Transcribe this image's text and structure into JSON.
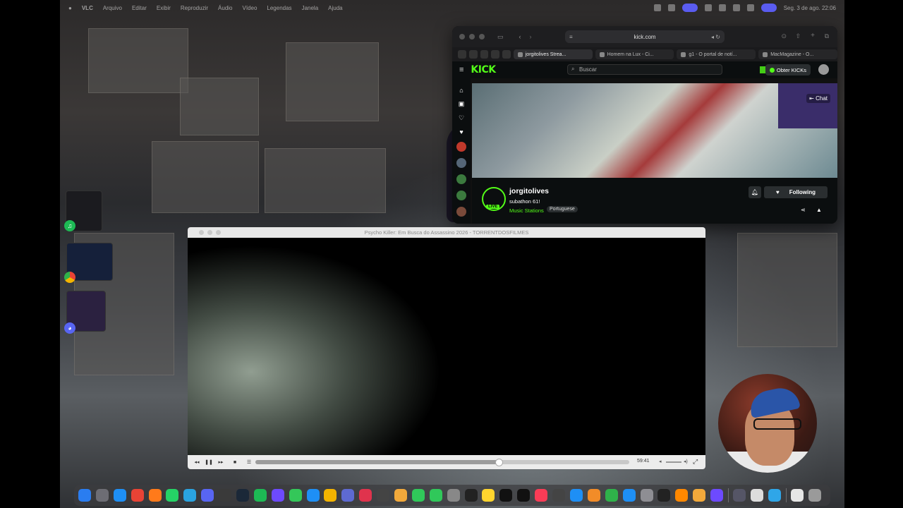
{
  "menubar": {
    "apple": "",
    "app_name": "VLC",
    "items": [
      "Arquivo",
      "Editar",
      "Exibir",
      "Reproduzir",
      "Áudio",
      "Vídeo",
      "Legendas",
      "Janela",
      "Ajuda"
    ],
    "clock": "Seg. 3 de ago. 22:06"
  },
  "stage_manager": [
    {
      "app": "Spotify",
      "icon": "spotify-icon",
      "color": "#1db954"
    },
    {
      "app": "Chrome",
      "icon": "chrome-icon",
      "color": "#e9c32c"
    },
    {
      "app": "Discord",
      "icon": "discord-icon",
      "color": "#5865f2"
    }
  ],
  "browser": {
    "url": "kick.com",
    "tabs": [
      {
        "label": "jorgitolives Strea...",
        "active": true
      },
      {
        "label": "Homem na Lux - Ci...",
        "active": false
      },
      {
        "label": "g1 - O portal de notí...",
        "active": false
      },
      {
        "label": "MacMagazine - O...",
        "active": false
      }
    ],
    "kick": {
      "logo": "KICK",
      "search_placeholder": "Buscar",
      "get_kicks_label": "Obter KICKs",
      "chat_label": "Chat",
      "channel": {
        "name": "jorgitolives",
        "title": "subathon 61!",
        "category": "Music Stations",
        "tag": "Portuguese",
        "live_badge": "LIVE",
        "follow_label": "Following"
      }
    }
  },
  "vlc": {
    "title": "Psycho Killer: Em Busca do Assassino 2026 - TORRENTDOSFILMES",
    "elapsed": "59:41",
    "progress": 0.65
  },
  "dock": {
    "apps": [
      {
        "name": "Finder",
        "icon": "finder-icon",
        "color": "#2a7df0"
      },
      {
        "name": "Launchpad",
        "icon": "launchpad-icon",
        "color": "#6d6d74"
      },
      {
        "name": "Safari",
        "icon": "safari-icon",
        "color": "#1e8ff5"
      },
      {
        "name": "Chrome",
        "icon": "chrome-icon",
        "color": "#e84335"
      },
      {
        "name": "Firefox",
        "icon": "firefox-icon",
        "color": "#ff7a1a"
      },
      {
        "name": "WhatsApp",
        "icon": "whatsapp-icon",
        "color": "#25d366"
      },
      {
        "name": "Telegram",
        "icon": "telegram-icon",
        "color": "#2aa3e0"
      },
      {
        "name": "Discord",
        "icon": "discord-icon",
        "color": "#5865f2"
      },
      {
        "name": "Audio",
        "icon": "audio-icon",
        "color": "#3a3a3a"
      },
      {
        "name": "Steam",
        "icon": "steam-icon",
        "color": "#1b2838"
      },
      {
        "name": "Spotify",
        "icon": "spotify-icon",
        "color": "#1db954"
      },
      {
        "name": "Proton",
        "icon": "shield-icon",
        "color": "#6d4aff"
      },
      {
        "name": "Messages",
        "icon": "messages-icon",
        "color": "#34c759"
      },
      {
        "name": "Mail",
        "icon": "mail-icon",
        "color": "#1e8ff5"
      },
      {
        "name": "Drive",
        "icon": "drive-icon",
        "color": "#f4b400"
      },
      {
        "name": "Linear",
        "icon": "linear-icon",
        "color": "#5e6ad2"
      },
      {
        "name": "Shortcuts",
        "icon": "shortcuts-icon",
        "color": "#e0334d"
      },
      {
        "name": "Screenshot",
        "icon": "screenshot-icon",
        "color": "#444"
      },
      {
        "name": "Photos",
        "icon": "photos-icon",
        "color": "#f2a93b"
      },
      {
        "name": "FaceTime",
        "icon": "facetime-icon",
        "color": "#30c85a"
      },
      {
        "name": "Phone",
        "icon": "phone-icon",
        "color": "#30c85a"
      },
      {
        "name": "Contacts",
        "icon": "contacts-icon",
        "color": "#888"
      },
      {
        "name": "Activity",
        "icon": "activity-icon",
        "color": "#222"
      },
      {
        "name": "Notes",
        "icon": "notes-icon",
        "color": "#ffd52e"
      },
      {
        "name": "TV",
        "icon": "tv-icon",
        "color": "#111"
      },
      {
        "name": "Capcut",
        "icon": "capcut-icon",
        "color": "#111"
      },
      {
        "name": "Music",
        "icon": "music-icon",
        "color": "#fa3c56"
      },
      {
        "name": "Camera",
        "icon": "camera-icon",
        "color": "#444"
      },
      {
        "name": "App Store",
        "icon": "appstore-icon",
        "color": "#1e8ff5"
      },
      {
        "name": "Pages",
        "icon": "pages-icon",
        "color": "#f28c28"
      },
      {
        "name": "Numbers",
        "icon": "numbers-icon",
        "color": "#2fb24a"
      },
      {
        "name": "Keynote",
        "icon": "keynote-icon",
        "color": "#1e8ff5"
      },
      {
        "name": "Settings",
        "icon": "gear-icon",
        "color": "#8e8e93"
      },
      {
        "name": "Terminal",
        "icon": "terminal-icon",
        "color": "#222"
      },
      {
        "name": "VLC",
        "icon": "vlc-icon",
        "color": "#ff8800"
      },
      {
        "name": "Firefox Dev",
        "icon": "browser-icon",
        "color": "#f2a93b"
      },
      {
        "name": "Notion",
        "icon": "notion-icon",
        "color": "#6d4aff"
      }
    ],
    "recent": [
      {
        "name": "Downloads",
        "icon": "downloads-icon",
        "color": "#556"
      },
      {
        "name": "Document",
        "icon": "document-icon",
        "color": "#ddd"
      },
      {
        "name": "Browser",
        "icon": "browser-icon",
        "color": "#2fa6e8"
      }
    ],
    "trailing": [
      {
        "name": "Documents",
        "icon": "document-icon",
        "color": "#e6e6e6"
      },
      {
        "name": "Trash",
        "icon": "trash-icon",
        "color": "#9a9a9a"
      }
    ]
  }
}
